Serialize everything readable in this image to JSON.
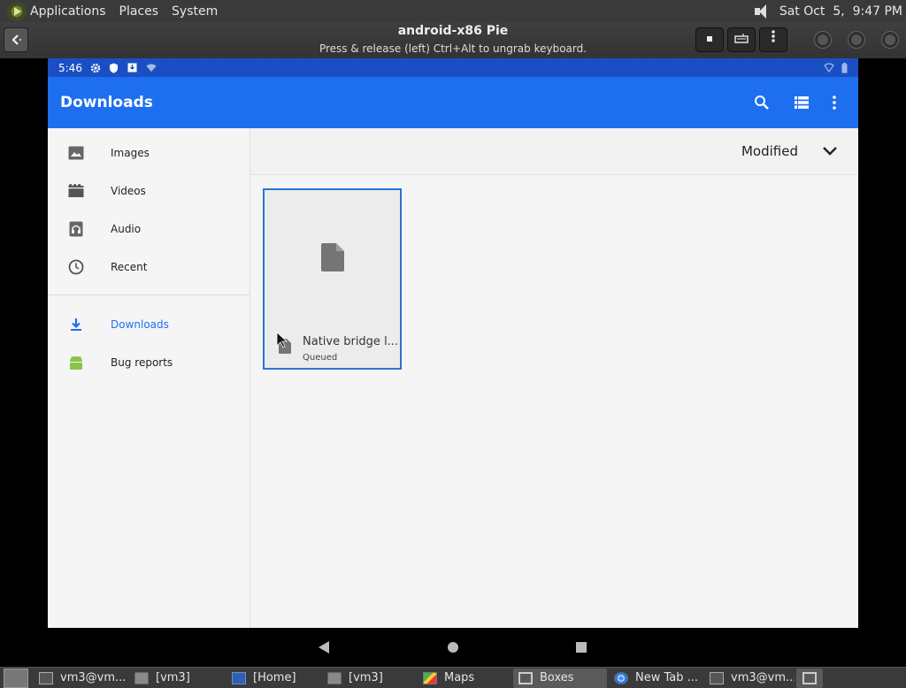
{
  "top_panel": {
    "menus": [
      "Applications",
      "Places",
      "System"
    ],
    "clock": "Sat Oct  5,  9:47 PM"
  },
  "window": {
    "title": "android-x86 Pie",
    "subtitle": "Press & release (left) Ctrl+Alt to ungrab keyboard."
  },
  "android": {
    "status_bar": {
      "time": "5:46"
    },
    "app_bar": {
      "title": "Downloads"
    },
    "drawer": {
      "items": [
        {
          "label": "Images",
          "icon": "image-icon"
        },
        {
          "label": "Videos",
          "icon": "video-icon"
        },
        {
          "label": "Audio",
          "icon": "audio-icon"
        },
        {
          "label": "Recent",
          "icon": "clock-icon"
        },
        {
          "label": "Downloads",
          "icon": "download-icon",
          "active": true
        },
        {
          "label": "Bug reports",
          "icon": "android-icon"
        }
      ]
    },
    "sort": {
      "label": "Modified"
    },
    "files": [
      {
        "name": "Native bridge l...",
        "status": "Queued"
      }
    ]
  },
  "taskbar": {
    "tasks": [
      {
        "label": "vm3@vm...",
        "icon": "terminal"
      },
      {
        "label": "[vm3]",
        "icon": "folder"
      },
      {
        "label": "[Home]",
        "icon": "doc"
      },
      {
        "label": "[vm3]",
        "icon": "folder"
      },
      {
        "label": "Maps",
        "icon": "maps"
      },
      {
        "label": "Boxes",
        "icon": "box",
        "active": true
      },
      {
        "label": "New Tab ...",
        "icon": "chrome"
      },
      {
        "label": "vm3@vm...",
        "icon": "terminal"
      }
    ]
  },
  "colors": {
    "android_primary": "#1e6ff0",
    "android_status": "#1a4fc4",
    "selection_border": "#2a73d8"
  }
}
